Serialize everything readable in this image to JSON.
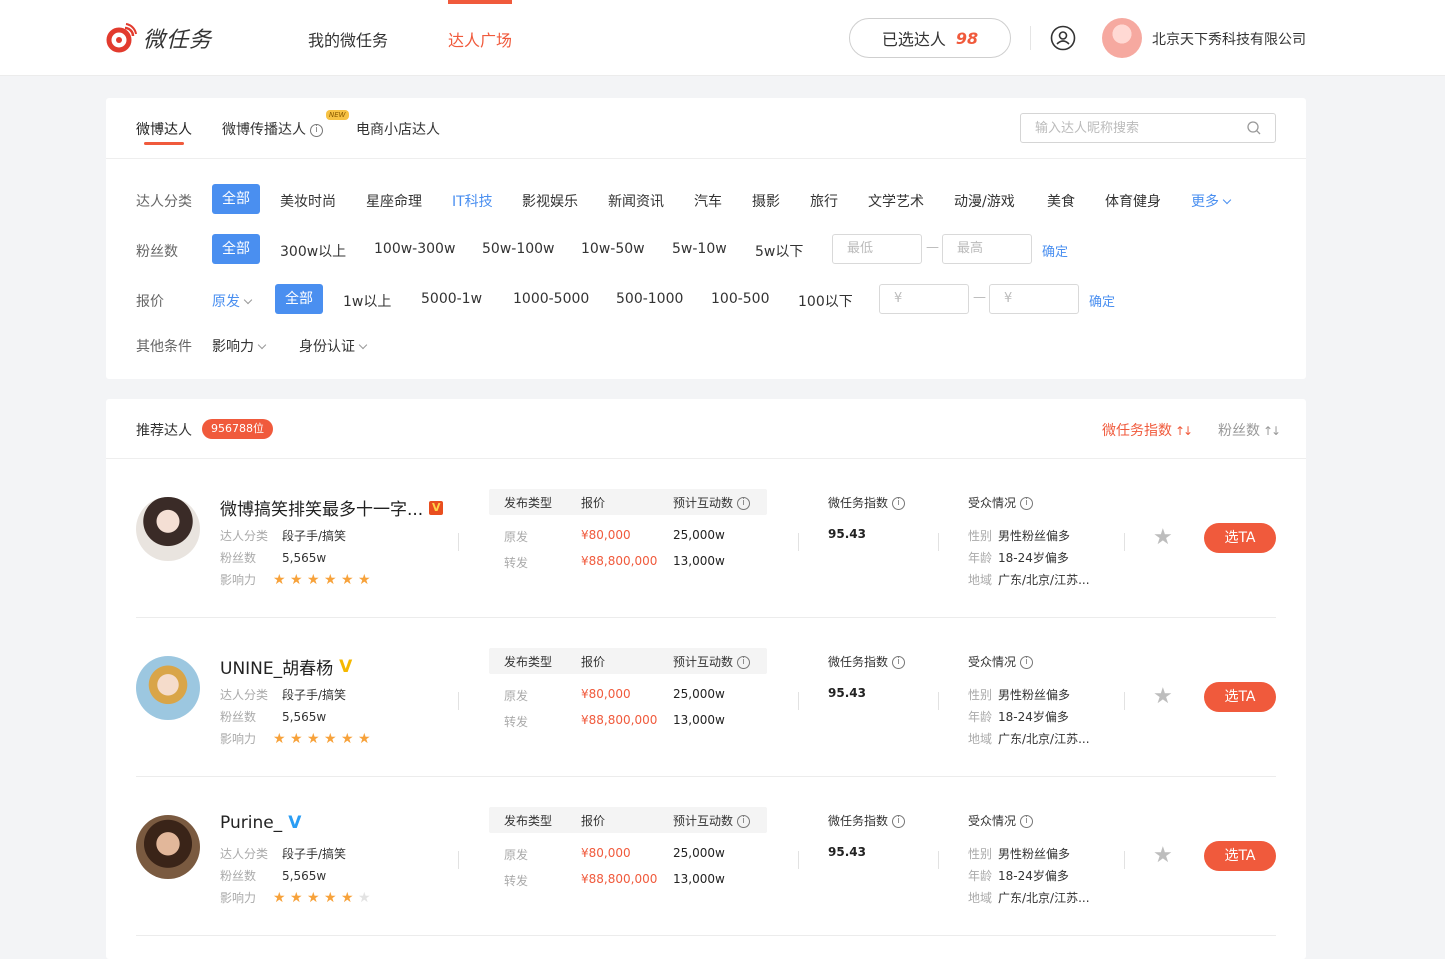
{
  "brand": {
    "name": "微任务"
  },
  "nav": {
    "items": [
      "我的微任务",
      "达人广场"
    ],
    "active": 1
  },
  "header": {
    "selected_label": "已选达人",
    "selected_count": "98",
    "company": "北京天下秀科技有限公司"
  },
  "tabs": {
    "items": [
      "微博达人",
      "微博传播达人",
      "电商小店达人"
    ],
    "new_badge": "NEW"
  },
  "search": {
    "placeholder": "输入达人昵称搜索"
  },
  "filters": {
    "category": {
      "label": "达人分类",
      "options": [
        "全部",
        "美妆时尚",
        "星座命理",
        "IT科技",
        "影视娱乐",
        "新闻资讯",
        "汽车",
        "摄影",
        "旅行",
        "文学艺术",
        "动漫/游戏",
        "美食",
        "体育健身"
      ],
      "more": "更多"
    },
    "fans": {
      "label": "粉丝数",
      "options": [
        "全部",
        "300w以上",
        "100w-300w",
        "50w-100w",
        "10w-50w",
        "5w-10w",
        "5w以下"
      ],
      "min_placeholder": "最低",
      "max_placeholder": "最高",
      "confirm": "确定"
    },
    "price": {
      "label": "报价",
      "type": "原发",
      "options": [
        "全部",
        "1w以上",
        "5000-1w",
        "1000-5000",
        "500-1000",
        "100-500",
        "100以下"
      ],
      "currency": "¥",
      "confirm": "确定"
    },
    "other": {
      "label": "其他条件",
      "options": [
        "影响力",
        "身份认证"
      ]
    }
  },
  "list": {
    "title": "推荐达人",
    "count": "956788位",
    "sort_index": "微任务指数",
    "sort_fans": "粉丝数",
    "col_labels": {
      "type": "发布类型",
      "price": "报价",
      "interact": "预计互动数",
      "index": "微任务指数",
      "audience": "受众情况",
      "category": "达人分类",
      "fans": "粉丝数",
      "influence": "影响力",
      "gender": "性别",
      "age": "年龄",
      "region": "地域",
      "original": "原发",
      "repost": "转发",
      "pick": "选TA"
    },
    "rows": [
      {
        "name": "微博搞笑排笑最多十一字...",
        "badge": "red",
        "category": "段子手/搞笑",
        "fans": "5,565w",
        "stars": 6,
        "orig_price": "¥80,000",
        "orig_interact": "25,000w",
        "repost_price": "¥88,800,000",
        "repost_interact": "13,000w",
        "index": "95.43",
        "gender": "男性粉丝偏多",
        "age": "18-24岁偏多",
        "region": "广东/北京/江苏..."
      },
      {
        "name": "UNINE_胡春杨",
        "badge": "gold",
        "category": "段子手/搞笑",
        "fans": "5,565w",
        "stars": 6,
        "orig_price": "¥80,000",
        "orig_interact": "25,000w",
        "repost_price": "¥88,800,000",
        "repost_interact": "13,000w",
        "index": "95.43",
        "gender": "男性粉丝偏多",
        "age": "18-24岁偏多",
        "region": "广东/北京/江苏..."
      },
      {
        "name": "Purine_",
        "badge": "blue",
        "category": "段子手/搞笑",
        "fans": "5,565w",
        "stars": 5,
        "orig_price": "¥80,000",
        "orig_interact": "25,000w",
        "repost_price": "¥88,800,000",
        "repost_interact": "13,000w",
        "index": "95.43",
        "gender": "男性粉丝偏多",
        "age": "18-24岁偏多",
        "region": "广东/北京/江苏..."
      }
    ]
  },
  "colors": {
    "accent": "#f05a3c",
    "blue": "#4a8ff0"
  }
}
